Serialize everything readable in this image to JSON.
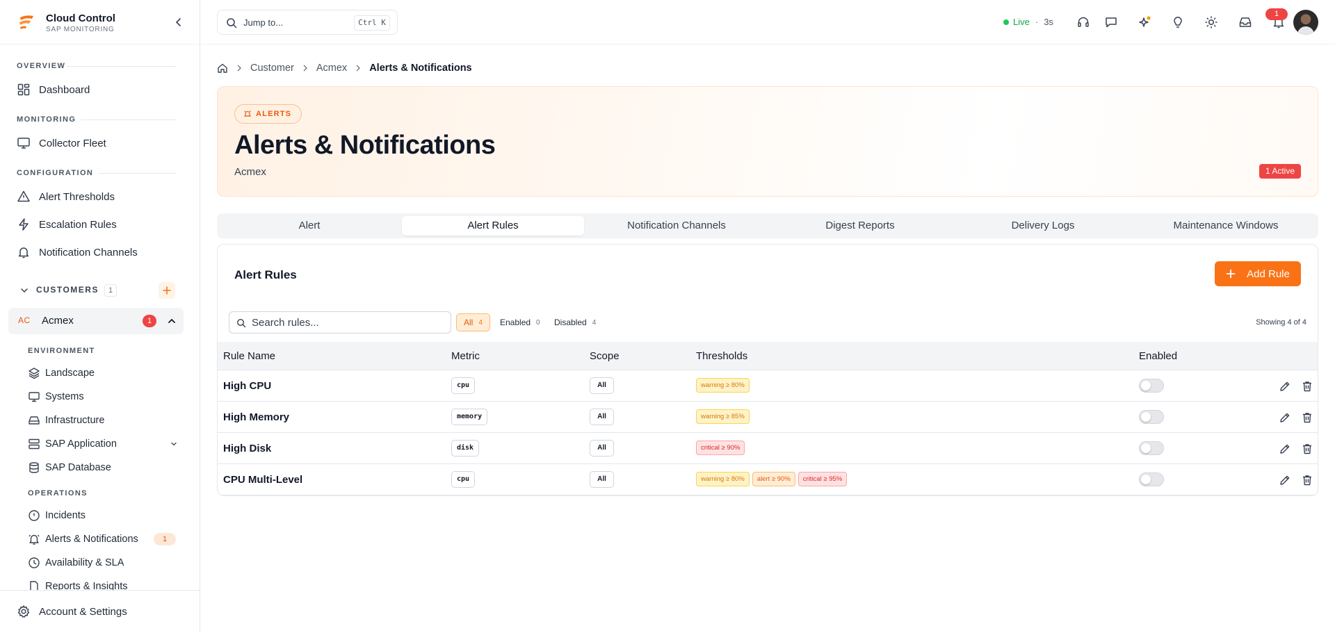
{
  "app": {
    "title": "Cloud Control",
    "subtitle": "SAP MONITORING",
    "brand_color": "#f97316"
  },
  "sidebar": {
    "sections": {
      "overview": "OVERVIEW",
      "monitoring": "MONITORING",
      "configuration": "CONFIGURATION"
    },
    "items": {
      "dashboard": "Dashboard",
      "collector_fleet": "Collector Fleet",
      "alert_thresholds": "Alert Thresholds",
      "escalation_rules": "Escalation Rules",
      "notification_channels": "Notification Channels"
    },
    "customers": {
      "label": "CUSTOMERS",
      "count": "1",
      "add_icon": "plus-icon"
    },
    "customer": {
      "initials": "AC",
      "name": "Acmex",
      "badge": "1"
    },
    "environment": {
      "label": "ENVIRONMENT",
      "items": [
        "Landscape",
        "Systems",
        "Infrastructure",
        "SAP Application",
        "SAP Database"
      ]
    },
    "operations": {
      "label": "OPERATIONS",
      "items": [
        "Incidents",
        "Alerts & Notifications",
        "Availability & SLA",
        "Reports & Insights"
      ],
      "alerts_badge": "1"
    },
    "footer": "Account & Settings"
  },
  "topbar": {
    "jump_placeholder": "Jump to...",
    "shortcut": "Ctrl K",
    "live_label": "Live",
    "live_separator": "·",
    "live_interval": "3s",
    "notification_count": "1",
    "icons": [
      "headset-icon",
      "chat-icon",
      "sparkle-icon",
      "lightbulb-icon",
      "sun-icon",
      "inbox-icon",
      "bell-icon"
    ]
  },
  "breadcrumb": {
    "items": [
      "Customer",
      "Acmex"
    ],
    "current": "Alerts & Notifications"
  },
  "hero": {
    "pill": "ALERTS",
    "title": "Alerts & Notifications",
    "subtitle": "Acmex",
    "active_badge": "1 Active"
  },
  "tabs": [
    "Alert",
    "Alert Rules",
    "Notification Channels",
    "Digest Reports",
    "Delivery Logs",
    "Maintenance Windows"
  ],
  "active_tab": "Alert Rules",
  "panel": {
    "title": "Alert Rules",
    "add_button": "Add Rule",
    "search_placeholder": "Search rules...",
    "filters": [
      {
        "label": "All",
        "count": "4"
      },
      {
        "label": "Enabled",
        "count": "0"
      },
      {
        "label": "Disabled",
        "count": "4"
      }
    ],
    "showing": "Showing 4 of 4"
  },
  "table": {
    "columns": [
      "Rule Name",
      "Metric",
      "Scope",
      "Thresholds",
      "Enabled"
    ],
    "rows": [
      {
        "name": "High CPU",
        "metric": "cpu",
        "scope": "All",
        "thresholds": [
          {
            "level": "warning",
            "text": "warning ≥ 80%"
          }
        ],
        "enabled": false
      },
      {
        "name": "High Memory",
        "metric": "memory",
        "scope": "All",
        "thresholds": [
          {
            "level": "warning",
            "text": "warning ≥ 85%"
          }
        ],
        "enabled": false
      },
      {
        "name": "High Disk",
        "metric": "disk",
        "scope": "All",
        "thresholds": [
          {
            "level": "critical",
            "text": "critical ≥ 90%"
          }
        ],
        "enabled": false
      },
      {
        "name": "CPU Multi-Level",
        "metric": "cpu",
        "scope": "All",
        "thresholds": [
          {
            "level": "warning",
            "text": "warning ≥ 80%"
          },
          {
            "level": "alert",
            "text": "alert ≥ 90%"
          },
          {
            "level": "critical",
            "text": "critical ≥ 95%"
          }
        ],
        "enabled": false
      }
    ]
  }
}
